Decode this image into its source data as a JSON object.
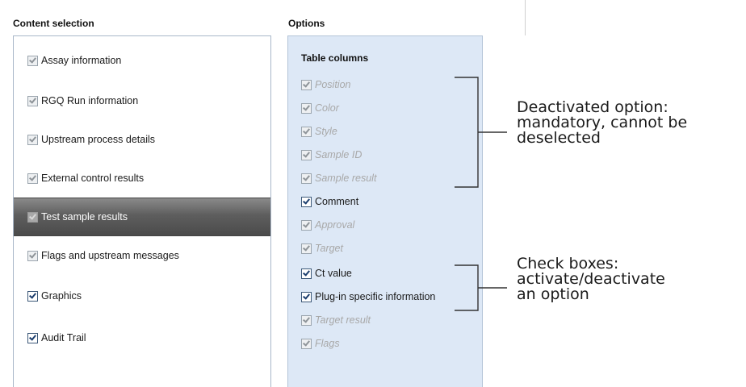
{
  "headings": {
    "content_selection": "Content selection",
    "options": "Options"
  },
  "content_selection": {
    "items": [
      {
        "label": "Assay information",
        "checked": true,
        "enabled": false
      },
      {
        "label": "RGQ Run information",
        "checked": true,
        "enabled": false
      },
      {
        "label": "Upstream process details",
        "checked": true,
        "enabled": false
      },
      {
        "label": "External control results",
        "checked": true,
        "enabled": false
      },
      {
        "label": "Test sample results",
        "checked": true,
        "enabled": false,
        "selected": true
      },
      {
        "label": "Flags and upstream messages",
        "checked": true,
        "enabled": false
      },
      {
        "label": "Graphics",
        "checked": true,
        "enabled": true
      },
      {
        "label": "Audit Trail",
        "checked": true,
        "enabled": true
      }
    ]
  },
  "options": {
    "group_title": "Table columns",
    "items": [
      {
        "label": "Position",
        "checked": true,
        "enabled": false
      },
      {
        "label": "Color",
        "checked": true,
        "enabled": false
      },
      {
        "label": "Style",
        "checked": true,
        "enabled": false
      },
      {
        "label": "Sample ID",
        "checked": true,
        "enabled": false
      },
      {
        "label": "Sample result",
        "checked": true,
        "enabled": false
      },
      {
        "label": "Comment",
        "checked": true,
        "enabled": true
      },
      {
        "label": "Approval",
        "checked": true,
        "enabled": false
      },
      {
        "label": "Target",
        "checked": true,
        "enabled": false
      },
      {
        "label": "Ct value",
        "checked": true,
        "enabled": true
      },
      {
        "label": "Plug-in specific information",
        "checked": true,
        "enabled": true
      },
      {
        "label": "Target result",
        "checked": true,
        "enabled": false
      },
      {
        "label": "Flags",
        "checked": true,
        "enabled": false
      }
    ]
  },
  "annotations": {
    "deactivated": "Deactivated option:\nmandatory, cannot be\ndeselected",
    "checkboxes": "Check boxes:\nactivate/deactivate\nan option"
  },
  "colors": {
    "options_background": "#dde8f6",
    "selected_row": "#5e5e5e",
    "checkbox_active": "#1c3e6e",
    "disabled_text": "#a8a8a8"
  }
}
